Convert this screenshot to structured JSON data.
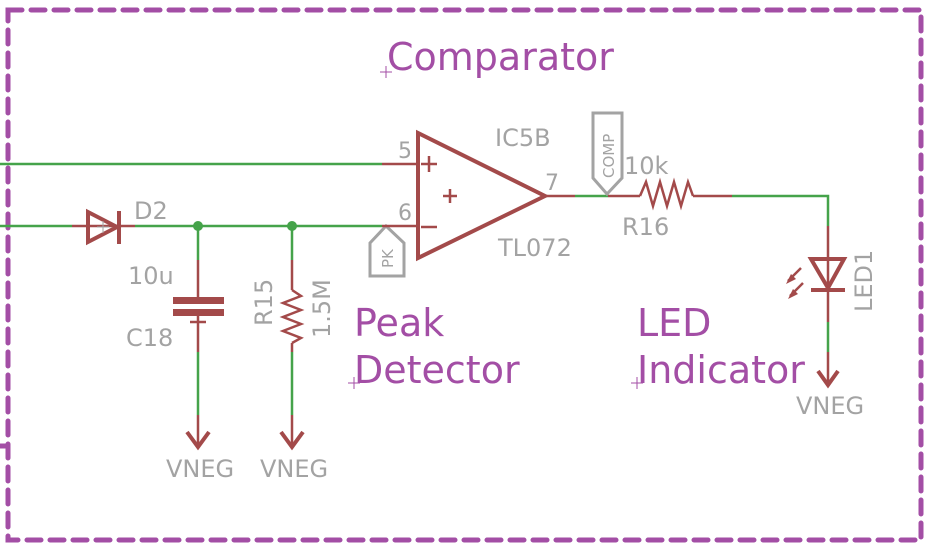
{
  "colors": {
    "frame": "#a34ea5",
    "wire": "#45a34a",
    "symbol": "#a34a4a",
    "label_gray": "#a3a3a3",
    "section_label": "#a34ea5"
  },
  "sections": {
    "comparator": "Comparator",
    "peak_detector_line1": "Peak",
    "peak_detector_line2": "Detector",
    "led_indicator_line1": "LED",
    "led_indicator_line2": "Indicator"
  },
  "opamp": {
    "name": "IC5B",
    "value": "TL072",
    "pin_noninv": "5",
    "pin_inv": "6",
    "pin_out": "7"
  },
  "diode": {
    "name": "D2"
  },
  "capacitor": {
    "name": "C18",
    "value": "10u"
  },
  "resistor_r15": {
    "name": "R15",
    "value": "1.5M"
  },
  "resistor_r16": {
    "name": "R16",
    "value": "10k"
  },
  "led": {
    "name": "LED1"
  },
  "net_labels": {
    "pk": "PK",
    "comp": "COMP"
  },
  "supplies": [
    "VNEG",
    "VNEG",
    "VNEG"
  ]
}
